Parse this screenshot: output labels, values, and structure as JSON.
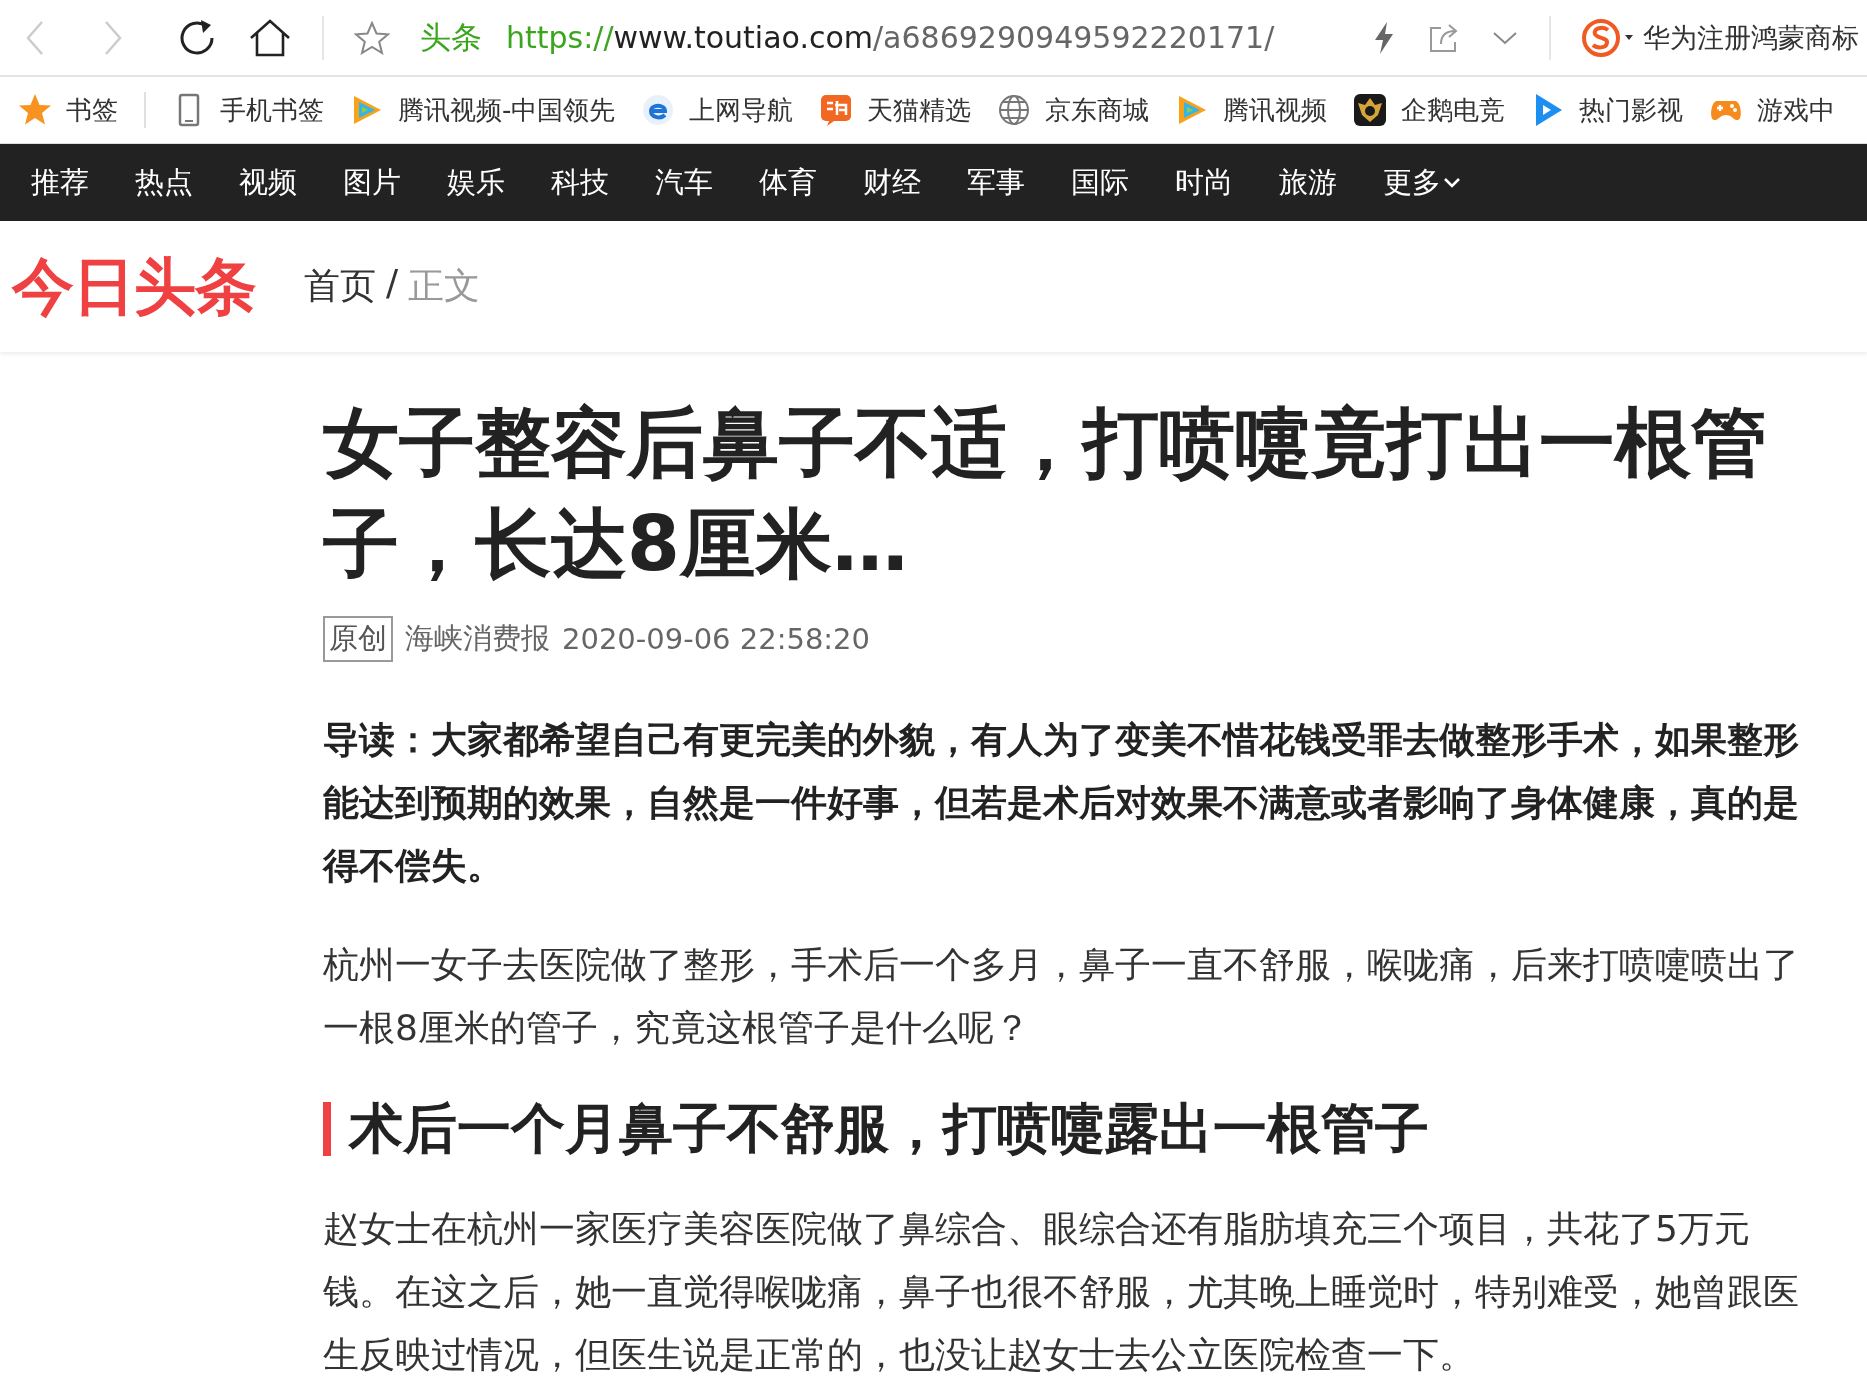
{
  "toolbar": {
    "nav_buttons": [
      {
        "kind": "back",
        "disabled": true
      },
      {
        "kind": "forward",
        "disabled": true
      }
    ],
    "site_label": "头条",
    "url": {
      "scheme": "https://",
      "host": "www.toutiao.com",
      "path": "/a6869290949592220171/"
    },
    "search_text": "华为注册鸿蒙商标"
  },
  "bookmarks": [
    {
      "kind": "star",
      "label": "书签"
    },
    {
      "kind": "phone",
      "label": "手机书签"
    },
    {
      "kind": "tencent",
      "label": "腾讯视频-中国领先"
    },
    {
      "kind": "ie",
      "label": "上网导航"
    },
    {
      "kind": "tmall",
      "label": "天猫精选"
    },
    {
      "kind": "globe",
      "label": "京东商城"
    },
    {
      "kind": "tencent",
      "label": "腾讯视频"
    },
    {
      "kind": "badge",
      "label": "企鹅电竞"
    },
    {
      "kind": "blueplay",
      "label": "热门影视"
    },
    {
      "kind": "gamepad",
      "label": "游戏中"
    }
  ],
  "nav": [
    {
      "label": "推荐",
      "dropdown": false
    },
    {
      "label": "热点",
      "dropdown": false
    },
    {
      "label": "视频",
      "dropdown": false
    },
    {
      "label": "图片",
      "dropdown": false
    },
    {
      "label": "娱乐",
      "dropdown": false
    },
    {
      "label": "科技",
      "dropdown": false
    },
    {
      "label": "汽车",
      "dropdown": false
    },
    {
      "label": "体育",
      "dropdown": false
    },
    {
      "label": "财经",
      "dropdown": false
    },
    {
      "label": "军事",
      "dropdown": false
    },
    {
      "label": "国际",
      "dropdown": false
    },
    {
      "label": "时尚",
      "dropdown": false
    },
    {
      "label": "旅游",
      "dropdown": false
    },
    {
      "label": "更多",
      "dropdown": true
    }
  ],
  "header": {
    "logo": "今日头条",
    "breadcrumb": [
      {
        "label": "首页",
        "current": false
      },
      {
        "label": "/",
        "current": false
      },
      {
        "label": "正文",
        "current": true
      }
    ]
  },
  "article": {
    "title": "女子整容后鼻子不适，打喷嚏竟打出一根管子，长达8厘米…",
    "tag": "原创",
    "source": "海峡消费报",
    "time": "2020-09-06 22:58:20",
    "blocks": [
      {
        "kind": "lead",
        "text": "导读：大家都希望自己有更完美的外貌，有人为了变美不惜花钱受罪去做整形手术，如果整形能达到预期的效果，自然是一件好事，但若是术后对效果不满意或者影响了身体健康，真的是得不偿失。"
      },
      {
        "kind": "paragraph",
        "text": "杭州一女子去医院做了整形，手术后一个多月，鼻子一直不舒服，喉咙痛，后来打喷嚏喷出了一根8厘米的管子，究竟这根管子是什么呢？"
      },
      {
        "kind": "heading",
        "text": "术后一个月鼻子不舒服，打喷嚏露出一根管子"
      },
      {
        "kind": "paragraph",
        "text": "赵女士在杭州一家医疗美容医院做了鼻综合、眼综合还有脂肪填充三个项目，共花了5万元钱。在这之后，她一直觉得喉咙痛，鼻子也很不舒服，尤其晚上睡觉时，特别难受，她曾跟医生反映过情况，但医生说是正常的，也没让赵女士去公立医院检查一下。"
      }
    ]
  }
}
